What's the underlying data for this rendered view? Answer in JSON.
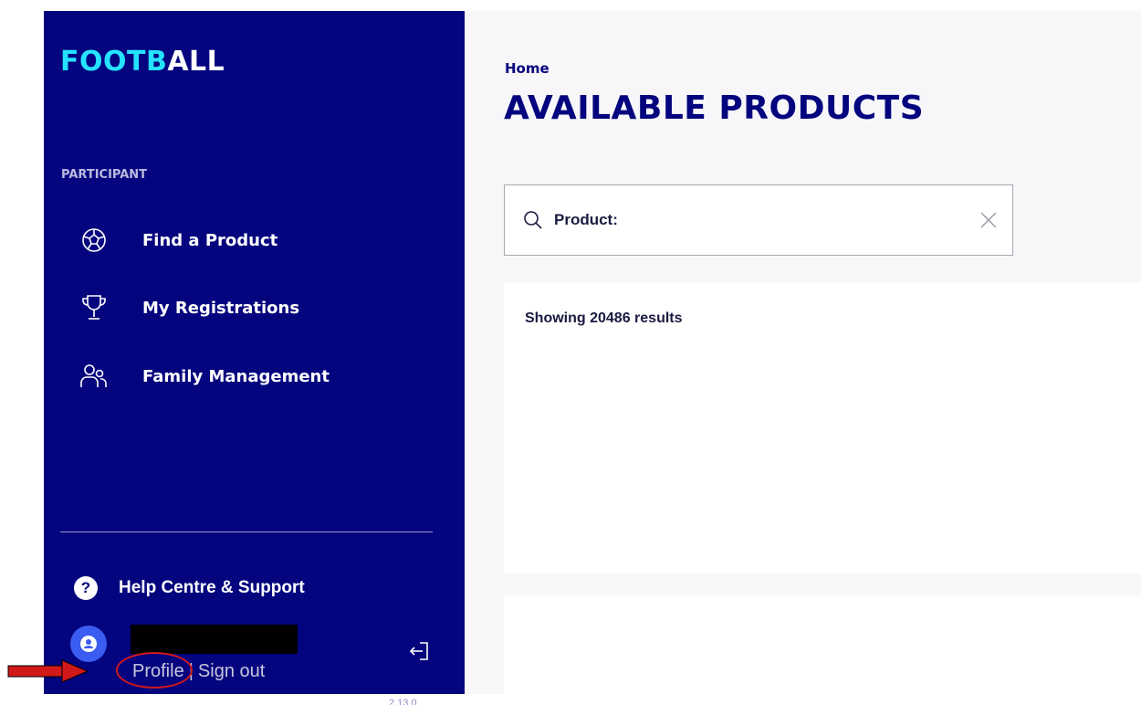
{
  "sidebar": {
    "logo": {
      "part1": "FOOTB",
      "part2": "ALL"
    },
    "section_label": "PARTICIPANT",
    "items": [
      {
        "label": "Find a Product",
        "icon": "football-icon"
      },
      {
        "label": "My Registrations",
        "icon": "trophy-icon"
      },
      {
        "label": "Family Management",
        "icon": "users-icon"
      }
    ],
    "help": {
      "icon_text": "?",
      "label": "Help Centre & Support"
    },
    "profile_link": "Profile",
    "separator": "|",
    "signout_link": "Sign out",
    "version": "2.13.0"
  },
  "main": {
    "breadcrumb": "Home",
    "title": "AVAILABLE PRODUCTS",
    "search": {
      "label": "Product:",
      "value": "",
      "placeholder": ""
    },
    "results_text": "Showing 20486 results"
  },
  "colors": {
    "sidebar_bg": "#04047e",
    "logo_accent": "#25e3ff",
    "avatar": "#3a5cf0",
    "annotation": "#d21919"
  }
}
